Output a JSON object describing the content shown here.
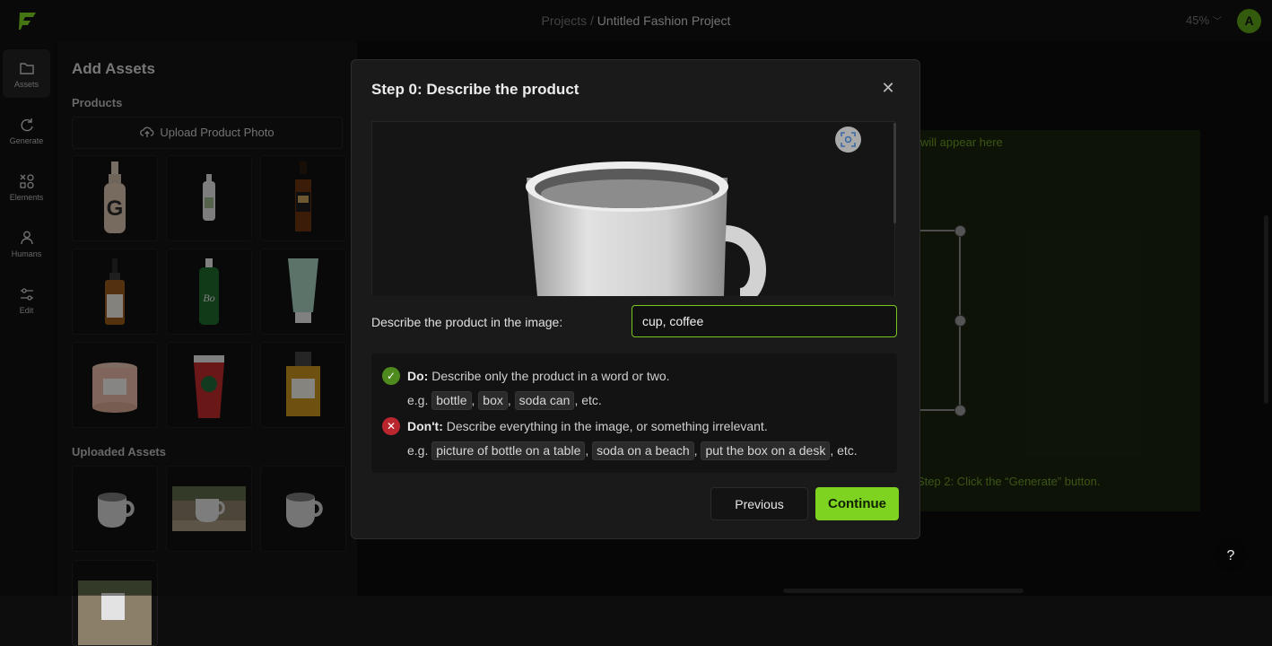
{
  "header": {
    "breadcrumb_root": "Projects",
    "breadcrumb_separator": " / ",
    "project_title": "Untitled Fashion Project",
    "zoom_level": "45%",
    "avatar_initial": "A"
  },
  "nav": {
    "items": [
      {
        "label": "Assets",
        "icon": "folder-icon",
        "active": true
      },
      {
        "label": "Generate",
        "icon": "refresh-icon",
        "active": false
      },
      {
        "label": "Elements",
        "icon": "shapes-icon",
        "active": false
      },
      {
        "label": "Humans",
        "icon": "person-icon",
        "active": false
      },
      {
        "label": "Edit",
        "icon": "sliders-icon",
        "active": false
      }
    ]
  },
  "assets_panel": {
    "title": "Add Assets",
    "products_label": "Products",
    "upload_label": "Upload Product Photo",
    "products": [
      {
        "name": "dropper-bottle-beige"
      },
      {
        "name": "small-white-bottle"
      },
      {
        "name": "whisky-bottle"
      },
      {
        "name": "serum-dropper-bottle"
      },
      {
        "name": "green-bottle"
      },
      {
        "name": "mint-tube"
      },
      {
        "name": "pink-candle"
      },
      {
        "name": "red-coffee-cup"
      },
      {
        "name": "perfume-bottle"
      }
    ],
    "uploaded_label": "Uploaded Assets",
    "uploaded": [
      {
        "name": "white-mug"
      },
      {
        "name": "mug-on-table-photo"
      },
      {
        "name": "white-mug-2"
      },
      {
        "name": "mug-photo-partial"
      }
    ]
  },
  "canvas": {
    "hint_top": "will appear here",
    "hint_bottom": "Step 2: Click the “Generate” button.",
    "help_label": "?"
  },
  "modal": {
    "title": "Step 0: Describe the product",
    "close_icon": "close-icon",
    "scan_icon": "focus-scan-icon",
    "describe_label": "Describe the product in the image:",
    "describe_value": "cup, coffee",
    "do": {
      "heading": "Do:",
      "text": " Describe only the product in a word or two.",
      "prefix": "e.g. ",
      "examples": [
        "bottle",
        "box",
        "soda can"
      ],
      "suffix": ", etc."
    },
    "dont": {
      "heading": "Don't:",
      "text": " Describe everything in the image, or something irrelevant.",
      "prefix": "e.g. ",
      "examples": [
        "picture of bottle on a table",
        "soda on a beach",
        "put the box on a desk"
      ],
      "suffix": ", etc."
    },
    "previous_label": "Previous",
    "continue_label": "Continue"
  },
  "colors": {
    "accent": "#7ed321",
    "danger": "#b9262e",
    "success": "#4e8a1e",
    "background": "#0d0d0d",
    "modal_bg": "#1a1a1a"
  }
}
